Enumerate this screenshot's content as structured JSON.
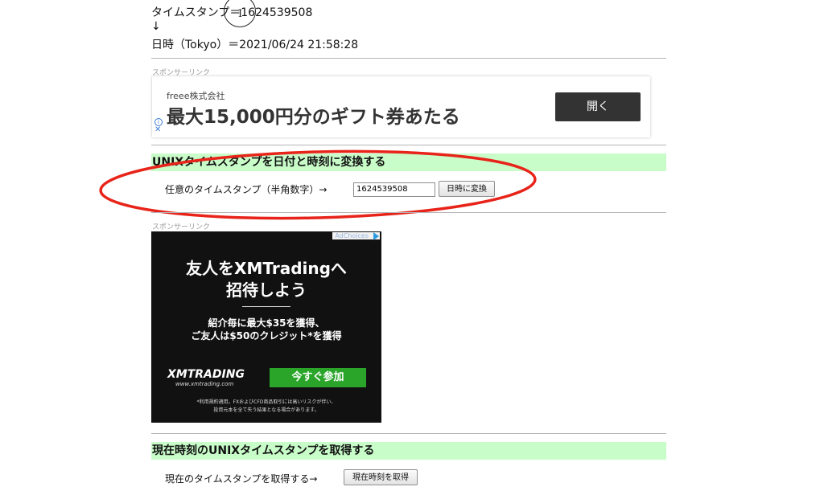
{
  "result": {
    "timestamp_line": "タイムスタンプ＝1624539508",
    "arrow": "↓",
    "datetime_line": "日時（Tokyo）＝2021/06/24 21:58:28"
  },
  "sponsor_label": "スポンサーリンク",
  "ad_top": {
    "advertiser": "freee株式会社",
    "headline": "最大15,000円分のギフト券あたる",
    "cta": "開く",
    "info_icon": "info-icon",
    "close_icon": "close-icon"
  },
  "convert_section": {
    "heading": "UNIXタイムスタンプを日付と時刻に変換する",
    "label": "任意のタイムスタンプ（半角数字）→",
    "input_value": "1624539508",
    "button": "日時に変換"
  },
  "ad_xm": {
    "adchoices": "AdChoices",
    "headline_1": "友人をXMTradingへ",
    "headline_2": "招待しよう",
    "body_1": "紹介毎に最大$35を獲得、",
    "body_2": "ご友人は$50のクレジット*を獲得",
    "brand": "XMTRADING",
    "brand_url": "www.xmtrading.com",
    "cta": "今すぐ参加",
    "disclaimer_1": "*利用規約適用。FXおよびCFD商品取引には高いリスクが伴い、",
    "disclaimer_2": "投資元本を全て失う結果となる場合があります。",
    "cta_color": "#2aa52a"
  },
  "now_section": {
    "heading": "現在時刻のUNIXタイムスタンプを取得する",
    "label": "現在のタイムスタンプを取得する→",
    "button": "現在時刻を取得"
  },
  "annotation": {
    "ellipse_color": "#e8241a"
  }
}
